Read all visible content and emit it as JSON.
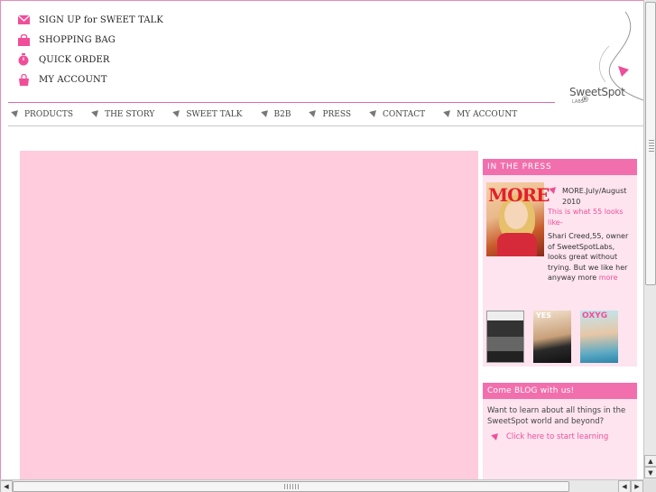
{
  "top_links": [
    {
      "label": "SIGN UP for SWEET TALK",
      "icon": "envelope-icon"
    },
    {
      "label": "SHOPPING BAG",
      "icon": "shopping-bag-icon"
    },
    {
      "label": "QUICK ORDER",
      "icon": "stopwatch-icon"
    },
    {
      "label": "MY ACCOUNT",
      "icon": "purse-icon"
    }
  ],
  "logo": {
    "brand": "SweetSpot",
    "sub": "LABS",
    "reg": "®"
  },
  "nav": [
    "PRODUCTS",
    "THE STORY",
    "SWEET TALK",
    "B2B",
    "PRESS",
    "CONTACT",
    "MY ACCOUNT"
  ],
  "press": {
    "heading": "IN THE PRESS",
    "magazine_masthead": "MORE",
    "issue": "MORE.July/August 2010",
    "headline": "This is what 55 looks like-",
    "body": "Shari Creed,55, owner of SweetSpotLabs, looks great without trying. But we like her anyway more",
    "more_link": "more",
    "thumb2_masthead": "YES",
    "thumb3_masthead": "OXYG"
  },
  "blog": {
    "heading": "Come BLOG with us!",
    "body": "Want to learn about all things in the SweetSpot world and beyond?",
    "link": "Click here to start learning"
  },
  "colors": {
    "accent": "#f26fad",
    "hero": "#ffccdd",
    "panel": "#fde4ef"
  }
}
